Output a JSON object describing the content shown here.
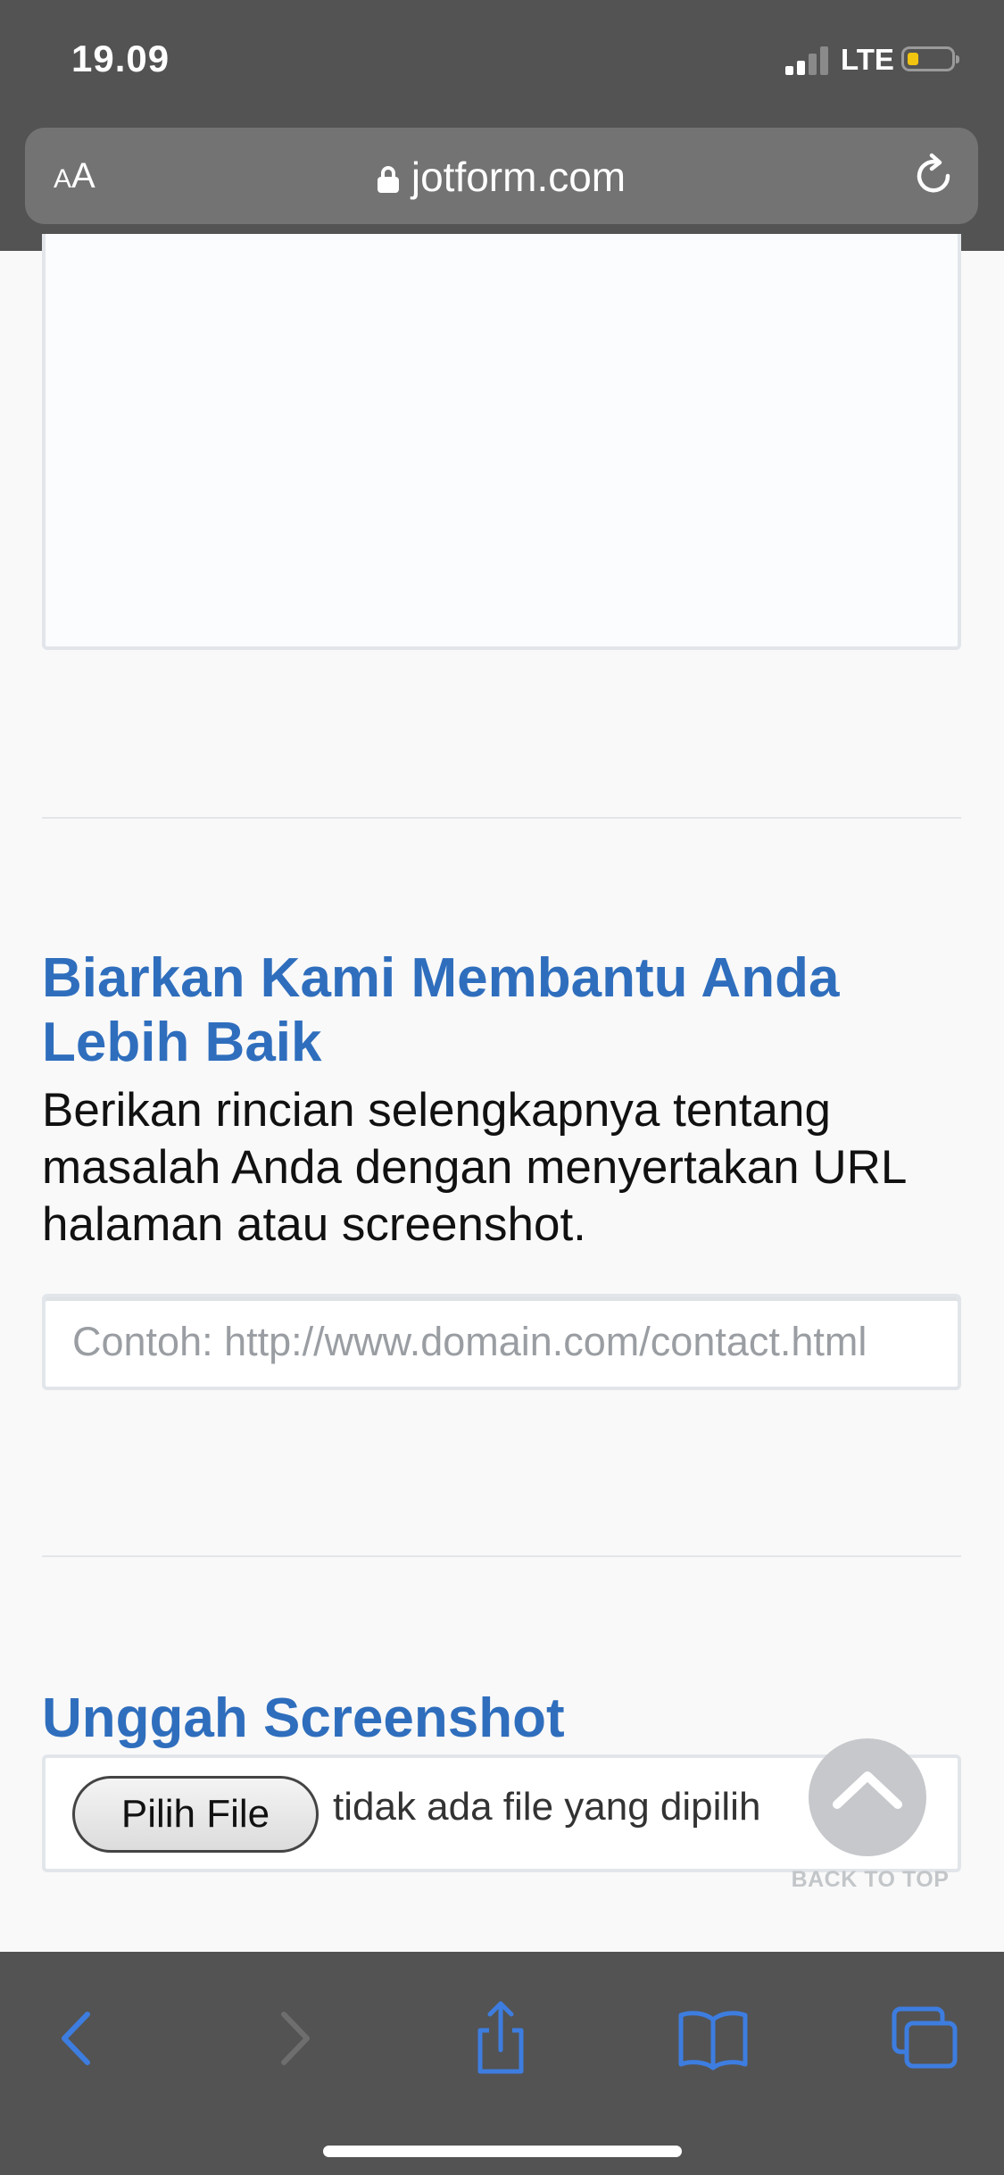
{
  "status_bar": {
    "time": "19.09",
    "network": "LTE",
    "battery_level": 0.2,
    "battery_color": "#f1c40f"
  },
  "browser": {
    "text_size_small": "A",
    "text_size_large": "A",
    "url": "jotform.com",
    "icons": [
      "lock-icon",
      "reload-icon"
    ]
  },
  "form": {
    "help_section": {
      "title": "Biarkan Kami Membantu Anda Lebih Baik",
      "description": "Berikan rincian selengkapnya tentang masalah Anda dengan menyertakan URL halaman atau screenshot.",
      "url_input": {
        "value": "",
        "placeholder": "Contoh: http://www.domain.com/contact.html"
      }
    },
    "upload_section": {
      "title": "Unggah Screenshot",
      "button_label": "Pilih File",
      "status": "tidak ada file yang dipilih"
    },
    "back_to_top": "BACK TO TOP",
    "title_color": "#2f6ebd"
  },
  "toolbar": {
    "icons": [
      "back-icon",
      "forward-icon",
      "share-icon",
      "bookmarks-icon",
      "tabs-icon"
    ],
    "accent": "#3d7de0"
  }
}
